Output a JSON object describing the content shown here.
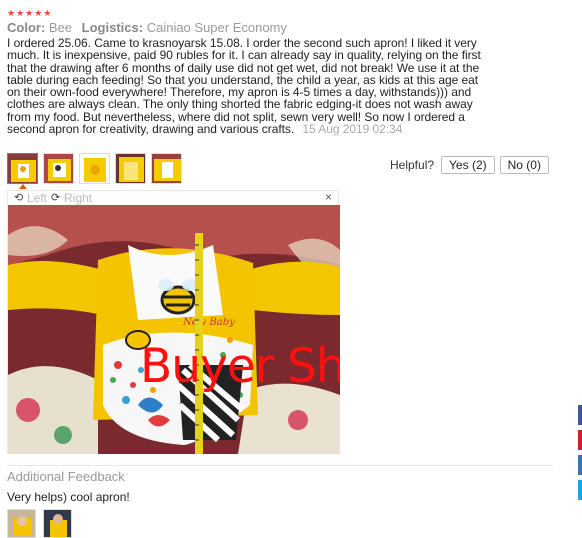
{
  "review": {
    "stars": "★★★★★",
    "color_label": "Color:",
    "color_value": "Bee",
    "logistics_label": "Logistics:",
    "logistics_value": "Cainiao Super Economy",
    "text": "I ordered 25.06. Came to krasnoyarsk 15.08. I order the second such apron! I liked it very much. It is inexpensive, paid 90 rubles for it. I can already say in quality, relying on the first that the drawing after 6 months of daily use did not get wet, did not break! We use it at the table during each feeding! So that you understand, the child a year, as kids at this age eat on their own-food everywhere! Therefore, my apron is 4-5 times a day, withstands))) and clothes are always clean. The only thing shorted the fabric edging-it does not wash away from my food. But nevertheless, where did not split, sewn very well! So now I ordered a second apron for creativity, drawing and various crafts.",
    "date": "15 Aug 2019 02:34"
  },
  "helpful": {
    "label": "Helpful?",
    "yes": "Yes (2)",
    "no": "No (0)"
  },
  "viewer": {
    "rotate_left_icon": "rotate-left-icon",
    "left": "Left",
    "rotate_right_icon": "rotate-right-icon",
    "right": "Right",
    "close": "×",
    "watermark": "Buyer Show"
  },
  "additional": {
    "title": "Additional Feedback",
    "text": "Very helps) cool apron!"
  },
  "colors": {
    "star": "#f44336",
    "accent": "#e65c00",
    "watermark": "#ff1010"
  }
}
